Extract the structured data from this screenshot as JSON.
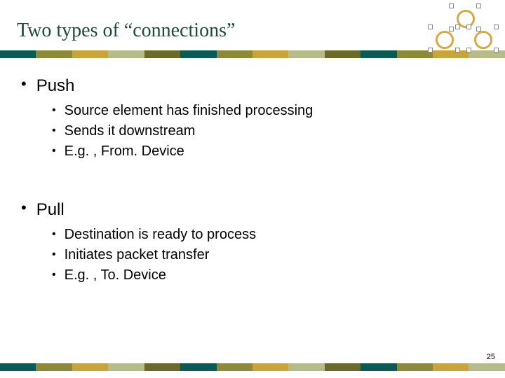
{
  "title": "Two types of “connections”",
  "sections": [
    {
      "heading": "Push",
      "items": [
        "Source element has finished processing",
        "Sends it downstream",
        "E.g. , From. Device"
      ]
    },
    {
      "heading": "Pull",
      "items": [
        "Destination is ready to process",
        "Initiates packet transfer",
        "E.g. , To. Device"
      ]
    }
  ],
  "page_number": "25",
  "bar_colors": [
    "#0b5a56",
    "#8c8a3a",
    "#c9a43a",
    "#b6bb8a",
    "#6b6a2a",
    "#0b5a56",
    "#8c8a3a",
    "#c9a43a",
    "#b6bb8a",
    "#6b6a2a",
    "#0b5a56",
    "#8c8a3a",
    "#c9a43a",
    "#b6bb8a"
  ]
}
